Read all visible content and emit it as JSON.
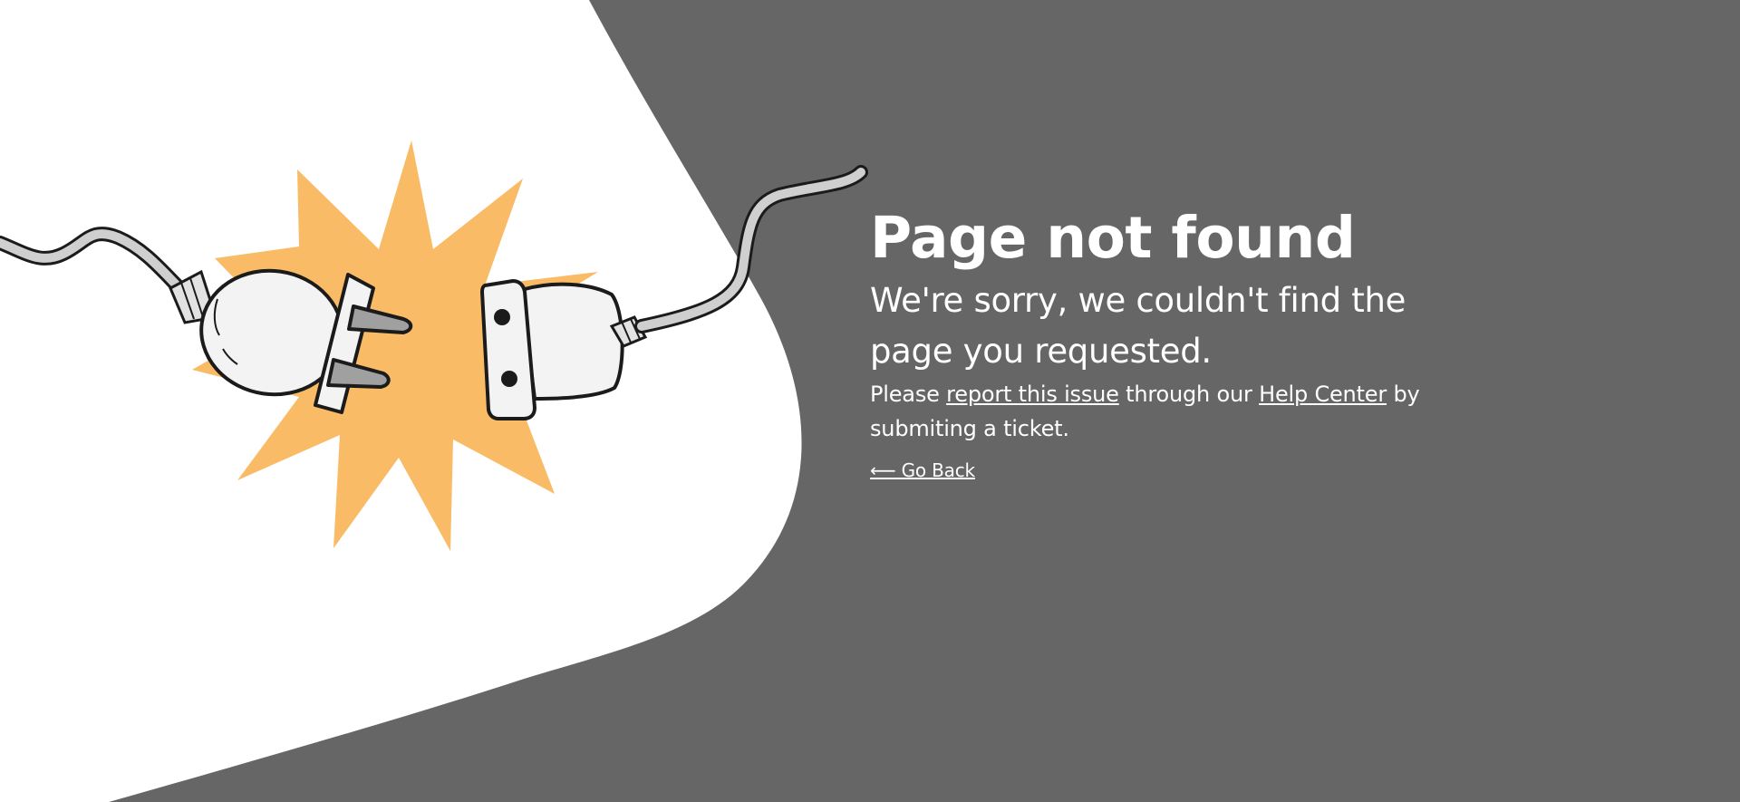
{
  "colors": {
    "background": "#666666",
    "blob": "#ffffff",
    "text": "#ffffff",
    "spark": "#f9bb66",
    "plug_fill": "#f3f3f3",
    "prong": "#a0a0a0",
    "outline": "#1b1b1b",
    "cable": "#cfcfcf"
  },
  "illustration": {
    "icon_names": [
      "unplugged-plug-icon",
      "spark-burst-icon",
      "socket-plug-icon",
      "cable-icon"
    ]
  },
  "content": {
    "title": "Page not found",
    "subtitle": "We're sorry, we couldn't find the page you requested.",
    "message_prefix": "Please ",
    "report_link": "report this issue",
    "message_middle": " through our ",
    "help_link": "Help Center",
    "message_suffix": " by submiting a ticket.",
    "back_link": "⟵ Go Back"
  }
}
